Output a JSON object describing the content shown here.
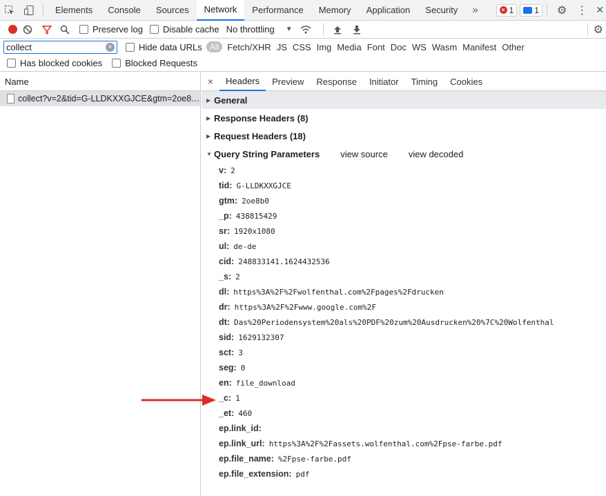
{
  "tabs": [
    "Elements",
    "Console",
    "Sources",
    "Network",
    "Performance",
    "Memory",
    "Application",
    "Security"
  ],
  "active_tab": "Network",
  "badges": {
    "errors": "1",
    "messages": "1"
  },
  "toolbar": {
    "preserve_log": "Preserve log",
    "disable_cache": "Disable cache",
    "throttling": "No throttling"
  },
  "filter": {
    "value": "collect",
    "hide_data_urls": "Hide data URLs",
    "types": [
      "All",
      "Fetch/XHR",
      "JS",
      "CSS",
      "Img",
      "Media",
      "Font",
      "Doc",
      "WS",
      "Wasm",
      "Manifest",
      "Other"
    ]
  },
  "blocked": {
    "has_blocked_cookies": "Has blocked cookies",
    "blocked_requests": "Blocked Requests"
  },
  "list": {
    "header": "Name",
    "request": "collect?v=2&tid=G-LLDKXXGJCE&gtm=2oe8…"
  },
  "detail_tabs": [
    "Headers",
    "Preview",
    "Response",
    "Initiator",
    "Timing",
    "Cookies"
  ],
  "sections": {
    "general": "General",
    "response": "Response Headers (8)",
    "request": "Request Headers (18)",
    "query": "Query String Parameters",
    "view_source": "view source",
    "view_decoded": "view decoded"
  },
  "params": [
    {
      "k": "v:",
      "v": "2"
    },
    {
      "k": "tid:",
      "v": "G-LLDKXXGJCE"
    },
    {
      "k": "gtm:",
      "v": "2oe8b0"
    },
    {
      "k": "_p:",
      "v": "438815429"
    },
    {
      "k": "sr:",
      "v": "1920x1080"
    },
    {
      "k": "ul:",
      "v": "de-de"
    },
    {
      "k": "cid:",
      "v": "248833141.1624432536"
    },
    {
      "k": "_s:",
      "v": "2"
    },
    {
      "k": "dl:",
      "v": "https%3A%2F%2Fwolfenthal.com%2Fpages%2Fdrucken"
    },
    {
      "k": "dr:",
      "v": "https%3A%2F%2Fwww.google.com%2F"
    },
    {
      "k": "dt:",
      "v": "Das%20Periodensystem%20als%20PDF%20zum%20Ausdrucken%20%7C%20Wolfenthal"
    },
    {
      "k": "sid:",
      "v": "1629132307"
    },
    {
      "k": "sct:",
      "v": "3"
    },
    {
      "k": "seg:",
      "v": "0"
    },
    {
      "k": "en:",
      "v": "file_download"
    },
    {
      "k": "_c:",
      "v": "1"
    },
    {
      "k": "_et:",
      "v": "460"
    },
    {
      "k": "ep.link_id:",
      "v": ""
    },
    {
      "k": "ep.link_url:",
      "v": "https%3A%2F%2Fassets.wolfenthal.com%2Fpse-farbe.pdf"
    },
    {
      "k": "ep.file_name:",
      "v": "%2Fpse-farbe.pdf"
    },
    {
      "k": "ep.file_extension:",
      "v": "pdf"
    }
  ],
  "colors": {
    "accent": "#1a73e8",
    "record": "#d93025",
    "annotation_arrow": "#d93025"
  }
}
